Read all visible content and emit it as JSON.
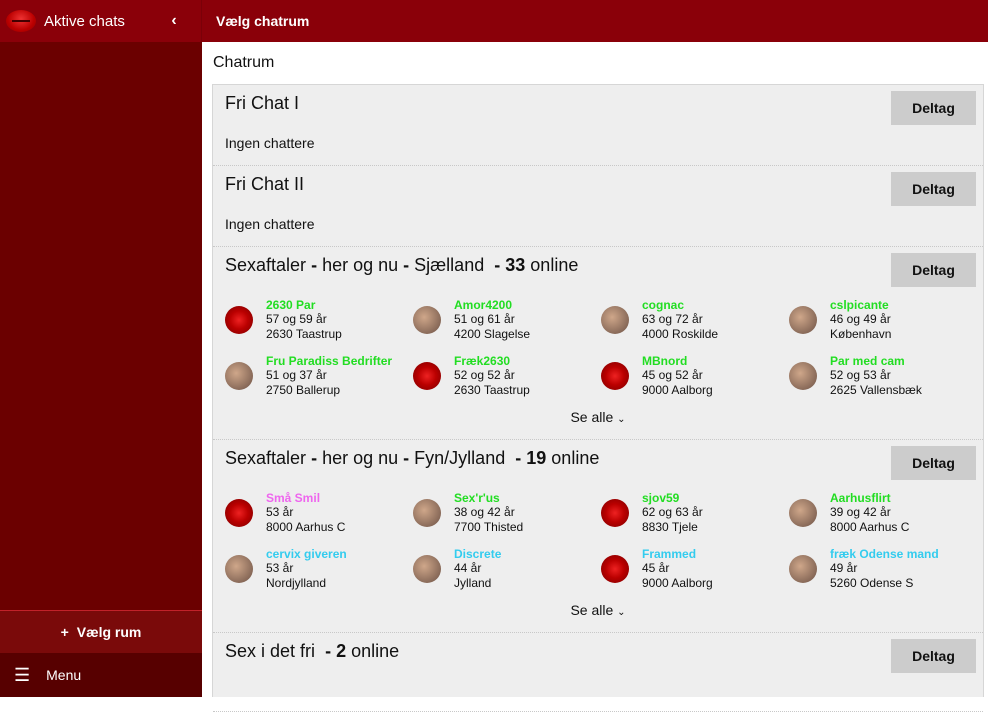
{
  "sidebar": {
    "title": "Aktive chats",
    "choose_room": "Vælg rum",
    "menu": "Menu"
  },
  "header": {
    "title": "Vælg chatrum",
    "subtitle": "Chatrum"
  },
  "colors": {
    "green": "#22dd22",
    "pink": "#ee66ee",
    "cyan": "#33ccee"
  },
  "join_label": "Deltag",
  "see_all": "Se alle",
  "online_word": "online",
  "rooms": [
    {
      "name": "Fri Chat I",
      "empty": "Ingen chattere"
    },
    {
      "name": "Fri Chat II",
      "empty": "Ingen chattere"
    },
    {
      "name": "Sexaftaler",
      "sep1": "-",
      "mid": "her og nu",
      "sep2": "-",
      "region": "Sjælland",
      "dash": "-",
      "count": "33",
      "users": [
        {
          "name": "2630 Par",
          "age": "57 og 59 år",
          "loc": "2630 Taastrup",
          "color": "green",
          "avatar": "lips"
        },
        {
          "name": "Amor4200",
          "age": "51 og 61 år",
          "loc": "4200 Slagelse",
          "color": "green",
          "avatar": "photo"
        },
        {
          "name": "cognac",
          "age": "63 og 72 år",
          "loc": "4000 Roskilde",
          "color": "green",
          "avatar": "photo"
        },
        {
          "name": "cslpicante",
          "age": "46 og 49 år",
          "loc": "København",
          "color": "green",
          "avatar": "photo"
        },
        {
          "name": "Fru Paradiss Bedrifter",
          "age": "51 og 37 år",
          "loc": "2750 Ballerup",
          "color": "green",
          "avatar": "photo"
        },
        {
          "name": "Fræk2630",
          "age": "52 og 52 år",
          "loc": "2630 Taastrup",
          "color": "green",
          "avatar": "lips"
        },
        {
          "name": "MBnord",
          "age": "45 og 52 år",
          "loc": "9000 Aalborg",
          "color": "green",
          "avatar": "lips"
        },
        {
          "name": "Par med cam",
          "age": "52 og 53 år",
          "loc": "2625 Vallensbæk",
          "color": "green",
          "avatar": "photo"
        }
      ]
    },
    {
      "name": "Sexaftaler",
      "sep1": "-",
      "mid": "her og nu",
      "sep2": "-",
      "region": "Fyn/Jylland",
      "dash": "-",
      "count": "19",
      "users": [
        {
          "name": "Små Smil",
          "age": "53 år",
          "loc": "8000 Aarhus C",
          "color": "pink",
          "avatar": "lips"
        },
        {
          "name": "Sex'r'us",
          "age": "38 og 42 år",
          "loc": "7700 Thisted",
          "color": "green",
          "avatar": "photo"
        },
        {
          "name": "sjov59",
          "age": "62 og 63 år",
          "loc": "8830 Tjele",
          "color": "green",
          "avatar": "lips"
        },
        {
          "name": "Aarhusflirt",
          "age": "39 og 42 år",
          "loc": "8000 Aarhus C",
          "color": "green",
          "avatar": "photo"
        },
        {
          "name": "cervix giveren",
          "age": "53 år",
          "loc": "Nordjylland",
          "color": "cyan",
          "avatar": "photo"
        },
        {
          "name": "Discrete",
          "age": "44 år",
          "loc": "Jylland",
          "color": "cyan",
          "avatar": "photo"
        },
        {
          "name": "Frammed",
          "age": "45 år",
          "loc": "9000 Aalborg",
          "color": "cyan",
          "avatar": "lips"
        },
        {
          "name": "fræk Odense mand",
          "age": "49 år",
          "loc": "5260 Odense S",
          "color": "cyan",
          "avatar": "photo"
        }
      ]
    },
    {
      "name": "Sex i det fri",
      "dash": "-",
      "count": "2"
    }
  ]
}
